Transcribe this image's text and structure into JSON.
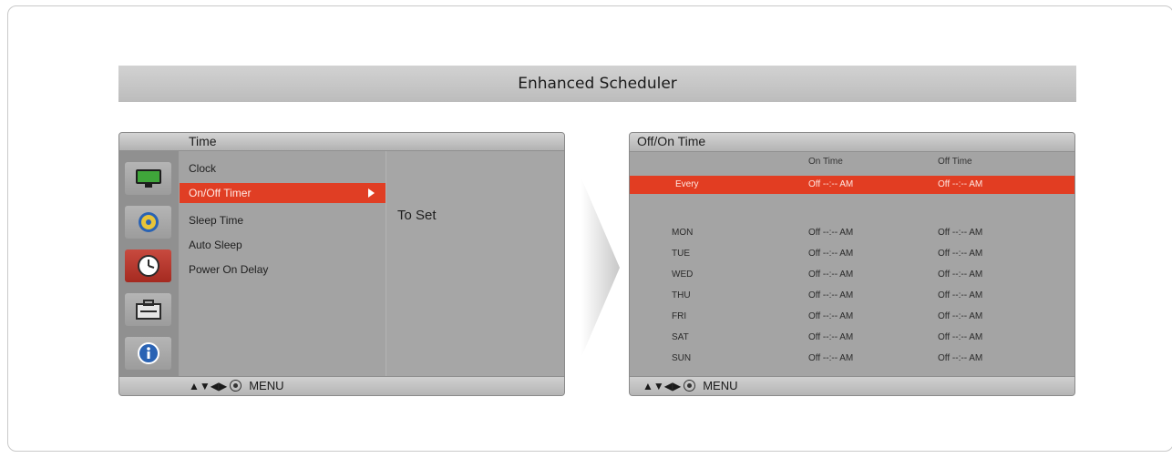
{
  "banner": {
    "title": "Enhanced Scheduler"
  },
  "left_osd": {
    "title": "Time",
    "icons": [
      "monitor-icon",
      "disc-icon",
      "clock-icon",
      "toolbox-icon",
      "info-icon"
    ],
    "active_icon_index": 2,
    "menu_items": [
      "Clock",
      "On/Off Timer",
      "Sleep Time",
      "Auto Sleep",
      "Power On Delay"
    ],
    "selected_index": 1,
    "sub_value": "To Set",
    "footer": {
      "nav_symbols": "▲▼◀▶",
      "menu_label": "MENU"
    }
  },
  "right_osd": {
    "title": "Off/On Time",
    "col_on": "On Time",
    "col_off": "Off Time",
    "every": {
      "day": "Every",
      "on": "Off  --:--  AM",
      "off": "Off  --:--  AM"
    },
    "days": [
      {
        "day": "MON",
        "on": "Off  --:--  AM",
        "off": "Off  --:--  AM"
      },
      {
        "day": "TUE",
        "on": "Off  --:--  AM",
        "off": "Off  --:--  AM"
      },
      {
        "day": "WED",
        "on": "Off  --:--  AM",
        "off": "Off  --:--  AM"
      },
      {
        "day": "THU",
        "on": "Off  --:--  AM",
        "off": "Off  --:--  AM"
      },
      {
        "day": "FRI",
        "on": "Off  --:--  AM",
        "off": "Off  --:--  AM"
      },
      {
        "day": "SAT",
        "on": "Off  --:--  AM",
        "off": "Off  --:--  AM"
      },
      {
        "day": "SUN",
        "on": "Off  --:--  AM",
        "off": "Off  --:--  AM"
      }
    ],
    "footer": {
      "nav_symbols": "▲▼◀▶",
      "menu_label": "MENU"
    }
  },
  "colors": {
    "highlight": "#e03e24",
    "panel": "#a3a3a3"
  }
}
